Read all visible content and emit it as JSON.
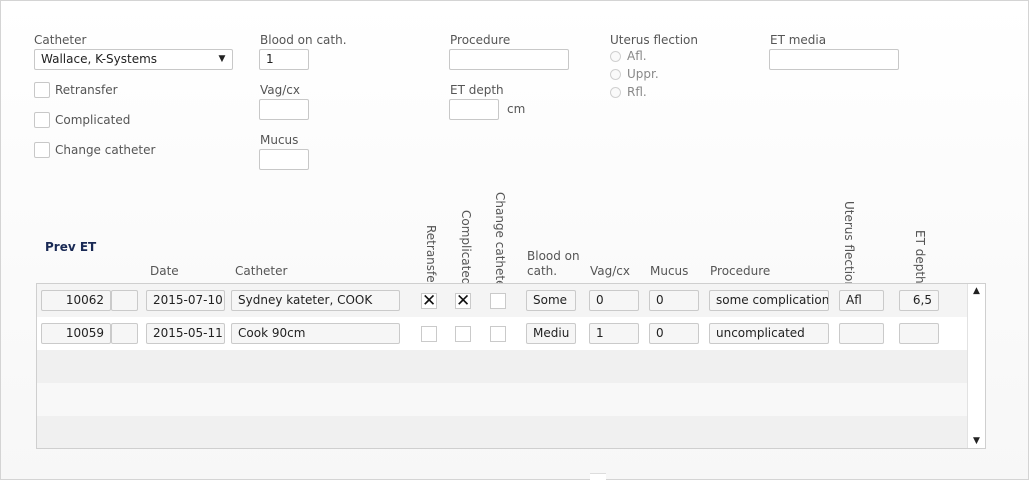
{
  "form": {
    "catheter": {
      "label": "Catheter",
      "value": "Wallace, K-Systems"
    },
    "retransfer_label": "Retransfer",
    "complicated_label": "Complicated",
    "change_catheter_label": "Change catheter",
    "blood_on_cath": {
      "label": "Blood on cath.",
      "value": "1"
    },
    "vag_cx": {
      "label": "Vag/cx",
      "value": ""
    },
    "mucus": {
      "label": "Mucus",
      "value": ""
    },
    "procedure": {
      "label": "Procedure",
      "value": ""
    },
    "et_depth": {
      "label": "ET depth",
      "value": "",
      "unit": "cm"
    },
    "uterus_flection": {
      "label": "Uterus flection",
      "options": [
        "Afl.",
        "Uppr.",
        "Rfl."
      ]
    },
    "et_media": {
      "label": "ET media",
      "value": ""
    }
  },
  "prev_et": {
    "title": "Prev ET",
    "columns": {
      "date": "Date",
      "catheter": "Catheter",
      "retransfer": "Retransfer",
      "complicated": "Complicated",
      "change_catheter": "Change catheter",
      "blood_on_cath": "Blood on cath.",
      "vag_cx": "Vag/cx",
      "mucus": "Mucus",
      "procedure": "Procedure",
      "uterus_flection": "Uterus flection",
      "et_depth": "ET depth"
    },
    "rows": [
      {
        "id": "10062",
        "date": "2015-07-10",
        "catheter": "Sydney kateter, COOK",
        "retransfer": true,
        "complicated": true,
        "change_catheter": false,
        "blood": "Some",
        "vag_cx": "0",
        "mucus": "0",
        "procedure": "some complication",
        "uterus": "Afl",
        "et_depth": "6,5"
      },
      {
        "id": "10059",
        "date": "2015-05-11",
        "catheter": "Cook 90cm",
        "retransfer": false,
        "complicated": false,
        "change_catheter": false,
        "blood": "Mediu",
        "vag_cx": "1",
        "mucus": "0",
        "procedure": "uncomplicated",
        "uterus": "",
        "et_depth": ""
      }
    ]
  },
  "icons": {
    "dropdown": "triangle-down",
    "scroll_up": "triangle-up",
    "scroll_down": "triangle-down",
    "checked": "x-mark"
  }
}
